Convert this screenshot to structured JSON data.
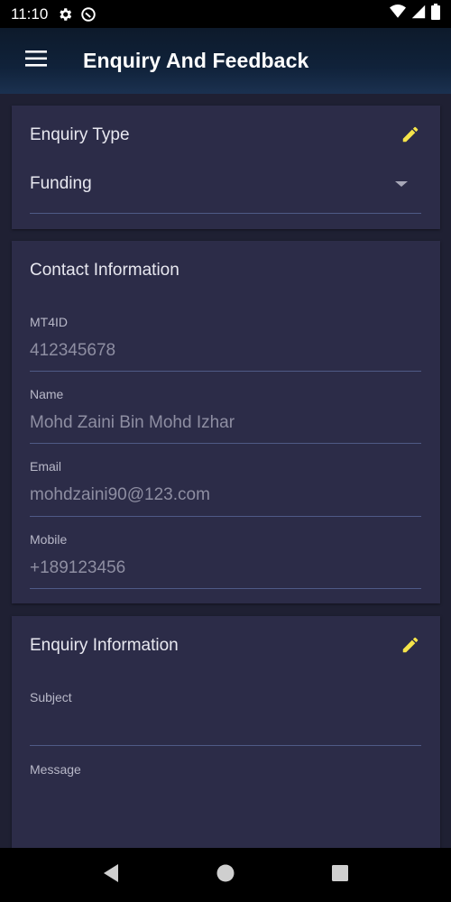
{
  "status_bar": {
    "time": "11:10",
    "icons": [
      "gear-icon",
      "do-not-disturb-icon",
      "wifi-icon",
      "signal-icon",
      "battery-icon"
    ]
  },
  "app_bar": {
    "title": "Enquiry And Feedback",
    "menu_icon": "hamburger-menu-icon"
  },
  "enquiry_type": {
    "title": "Enquiry Type",
    "selected": "Funding",
    "edit_icon": "pencil-icon"
  },
  "contact": {
    "title": "Contact Information",
    "fields": [
      {
        "label": "MT4ID",
        "value": "412345678"
      },
      {
        "label": "Name",
        "value": "Mohd Zaini Bin Mohd Izhar"
      },
      {
        "label": "Email",
        "value": "mohdzaini90@123.com"
      },
      {
        "label": "Mobile",
        "value": "+189123456"
      }
    ]
  },
  "enquiry_info": {
    "title": "Enquiry Information",
    "edit_icon": "pencil-icon",
    "subject_label": "Subject",
    "subject_value": "",
    "message_label": "Message",
    "message_value": ""
  },
  "nav_bar": {
    "icons": [
      "back-icon",
      "home-icon",
      "recents-icon"
    ]
  },
  "colors": {
    "background": "#1f2033",
    "card": "#2c2c48",
    "accent_edit": "#f5e44a",
    "divider": "#4f5a86"
  }
}
